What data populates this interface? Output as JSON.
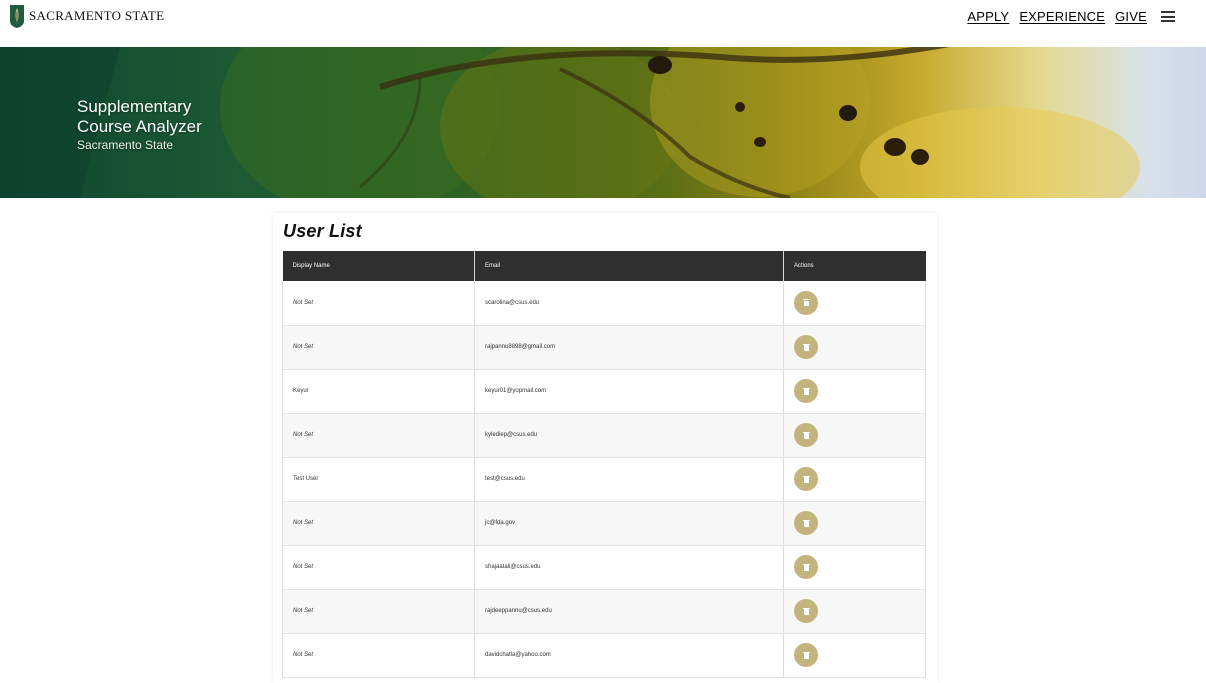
{
  "brand": {
    "name": "SACRAMENTO STATE"
  },
  "nav": {
    "items": [
      "APPLY",
      "EXPERIENCE",
      "GIVE"
    ],
    "menu_icon": "hamburger-icon"
  },
  "hero": {
    "title_line1": "Supplementary",
    "title_line2": "Course Analyzer",
    "subtitle": "Sacramento State"
  },
  "user_list": {
    "title": "User List",
    "columns": [
      "Display Name",
      "Email",
      "Actions"
    ],
    "action_icon": "trash-icon",
    "colors": {
      "header_bg": "#2f2f2f",
      "action_button": "#c4b37c"
    },
    "rows": [
      {
        "display_name": "Not Set",
        "email": "scarolina@csus.edu"
      },
      {
        "display_name": "Not Set",
        "email": "rajpannu8898@gmail.com"
      },
      {
        "display_name": "Keyur",
        "email": "keyur01@yopmail.com"
      },
      {
        "display_name": "Not Set",
        "email": "kylediep@csus.edu"
      },
      {
        "display_name": "Test User",
        "email": "test@csus.edu"
      },
      {
        "display_name": "Not Set",
        "email": "jc@fda.gov"
      },
      {
        "display_name": "Not Set",
        "email": "shajaatali@csus.edu"
      },
      {
        "display_name": "Not Set",
        "email": "rajdeeppannu@csus.edu"
      },
      {
        "display_name": "Not Set",
        "email": "davidchatla@yahoo.com"
      }
    ]
  }
}
